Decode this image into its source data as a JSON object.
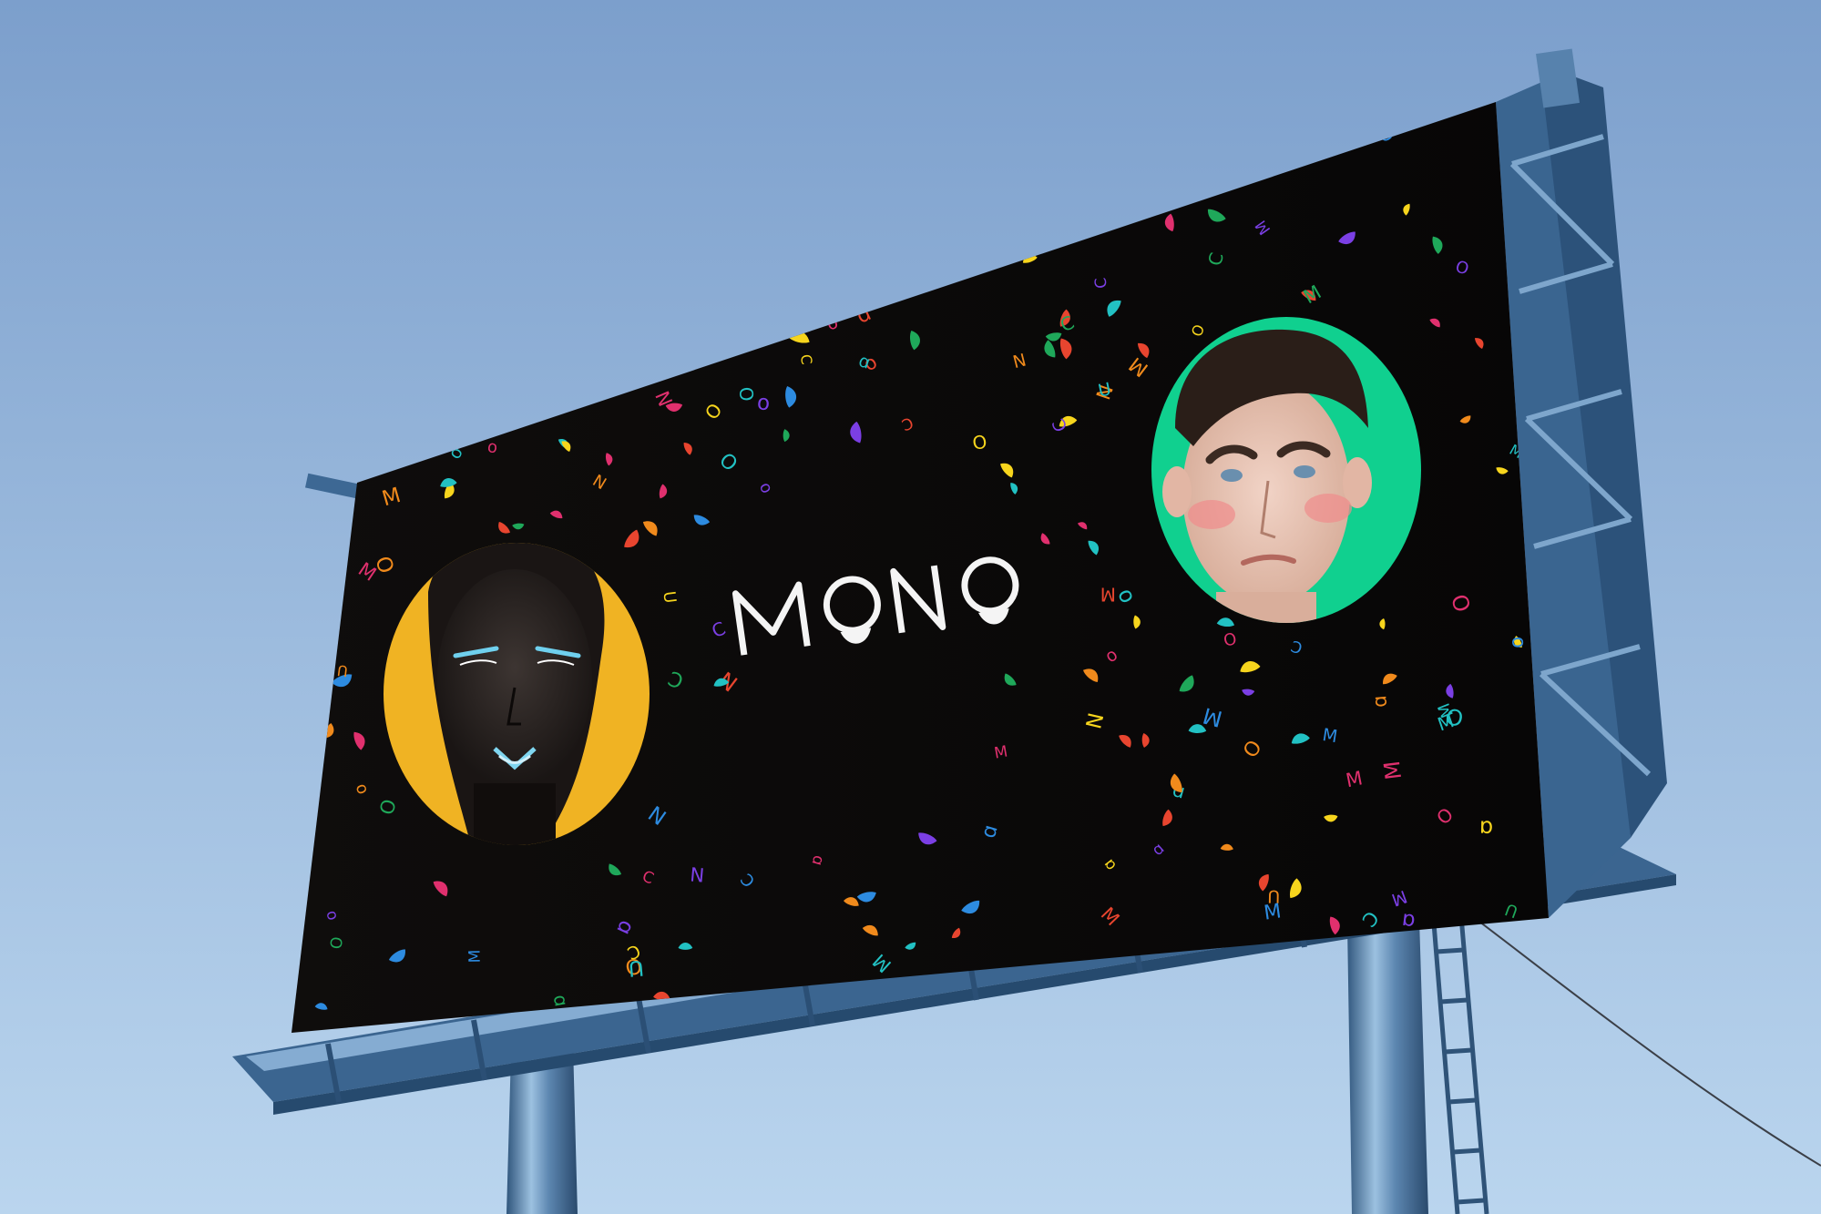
{
  "billboard": {
    "brand": "MONO",
    "colors": {
      "sky_top": "#7fa3cf",
      "sky_bottom": "#b7d3ec",
      "board": "#0b0a09",
      "steel": "#3f6a96",
      "steel_light": "#7fa6cc",
      "left_circle": "#f0b323",
      "right_circle": "#10d08f",
      "confetti": [
        "#e8452f",
        "#f7d51d",
        "#1fa85a",
        "#7b3fe4",
        "#2d8be0",
        "#f08a1c",
        "#e0306e",
        "#22c1c3"
      ]
    },
    "left_portrait": {
      "icon": "woman-portrait-face"
    },
    "right_portrait": {
      "icon": "man-portrait-face"
    }
  }
}
